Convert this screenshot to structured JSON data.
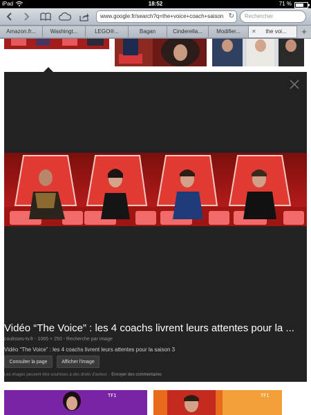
{
  "status_bar": {
    "device": "iPad",
    "time": "18:52",
    "battery": "71 %",
    "battery_level": 0.71
  },
  "toolbar": {
    "url": "www.google.fr/search?q=the+voice+coach+saison",
    "search_placeholder": "Rechercher"
  },
  "tabs": [
    {
      "label": "Amazon.fr..."
    },
    {
      "label": "Washingt..."
    },
    {
      "label": "LEGO®..."
    },
    {
      "label": "Bagan"
    },
    {
      "label": "Cinderella..."
    },
    {
      "label": "Modifier..."
    },
    {
      "label": "the voi..."
    }
  ],
  "preview": {
    "title": "Vidéo “The Voice” : les 4 coachs livrent leurs attentes pour la ...",
    "meta": "coulisses-tv.fr - 1065 × 250 - Recherche par image",
    "description": "Vidéo “The Voice” : les 4 coachs livrent leurs attentes pour la saison 3",
    "btn_visit": "Consulter la page",
    "btn_view": "Afficher l'image",
    "legal": "Les images peuvent être soumises à des droits d'auteur.",
    "feedback_link": "Envoyer des commentaires"
  },
  "colors": {
    "stage_red": "#c8201f",
    "panel_bg": "#222222"
  }
}
